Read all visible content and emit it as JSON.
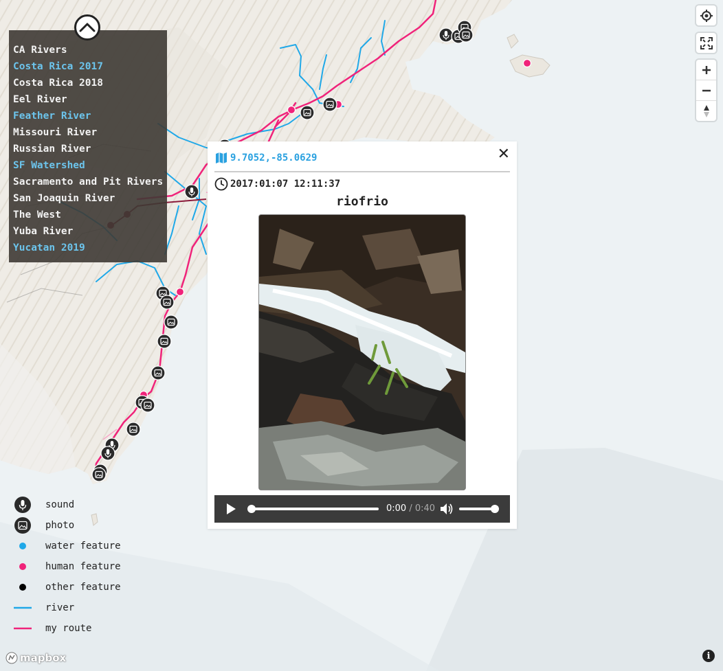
{
  "layers": {
    "items": [
      {
        "label": "CA Rivers",
        "active": false
      },
      {
        "label": "Costa Rica 2017",
        "active": true
      },
      {
        "label": "Costa Rica 2018",
        "active": false
      },
      {
        "label": "Eel River",
        "active": false
      },
      {
        "label": "Feather River",
        "active": true
      },
      {
        "label": "Missouri River",
        "active": false
      },
      {
        "label": "Russian River",
        "active": false
      },
      {
        "label": "SF Watershed",
        "active": true
      },
      {
        "label": "Sacramento and Pit Rivers",
        "active": false
      },
      {
        "label": "San Joaquin River",
        "active": false
      },
      {
        "label": "The West",
        "active": false
      },
      {
        "label": "Yuba River",
        "active": false
      },
      {
        "label": "Yucatan 2019",
        "active": true
      }
    ]
  },
  "popup": {
    "coords": "9.7052,-85.0629",
    "timestamp": "2017:01:07 12:11:37",
    "title": "riofrio",
    "audio": {
      "current": "0:00",
      "separator": " / ",
      "duration": "0:40",
      "progress": 0
    }
  },
  "legend": {
    "items": [
      {
        "label": "sound",
        "icon": "microphone-icon"
      },
      {
        "label": "photo",
        "icon": "photo-icon"
      },
      {
        "label": "water feature",
        "icon": "water-dot",
        "color": "#1fa8e8"
      },
      {
        "label": "human feature",
        "icon": "human-dot",
        "color": "#f0237a"
      },
      {
        "label": "other feature",
        "icon": "other-dot",
        "color": "#000000"
      },
      {
        "label": "river",
        "icon": "river-line",
        "color": "#1fa8e8"
      },
      {
        "label": "my route",
        "icon": "route-line",
        "color": "#f0237a"
      }
    ]
  },
  "attribution": {
    "logo": "mapbox",
    "info_icon": "info-icon"
  },
  "colors": {
    "water": "#1fa8e8",
    "route": "#f0237a",
    "panel": "#3e3a34",
    "active_layer": "#6cc4ec"
  }
}
